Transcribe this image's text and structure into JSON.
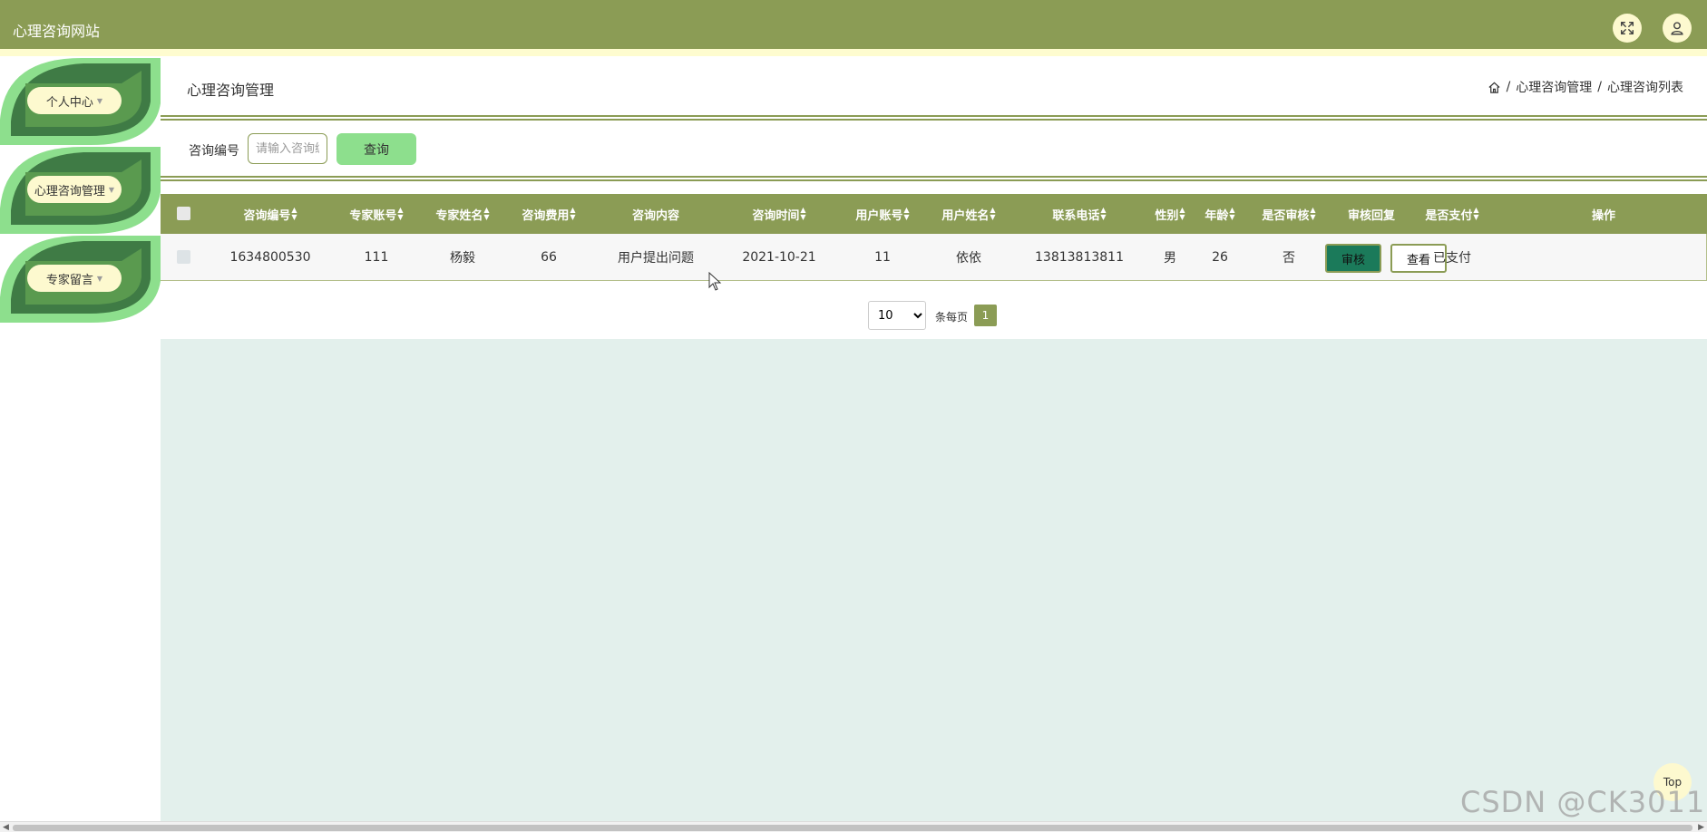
{
  "app": {
    "title": "心理咨询网站"
  },
  "header": {
    "fullscreen_icon": "expand-arrows-icon",
    "user_icon": "user-icon"
  },
  "sidebar": {
    "items": [
      {
        "label": "个人中心"
      },
      {
        "label": "心理咨询管理"
      },
      {
        "label": "专家留言"
      }
    ]
  },
  "page": {
    "title": "心理咨询管理",
    "breadcrumb": [
      "心理咨询管理",
      "心理咨询列表"
    ],
    "breadcrumb_sep": "/"
  },
  "search": {
    "label": "咨询编号",
    "placeholder": "请输入咨询编号",
    "button": "查询"
  },
  "table": {
    "columns": [
      {
        "label": "咨询编号",
        "sortable": true
      },
      {
        "label": "专家账号",
        "sortable": true
      },
      {
        "label": "专家姓名",
        "sortable": true
      },
      {
        "label": "咨询费用",
        "sortable": true
      },
      {
        "label": "咨询内容",
        "sortable": false
      },
      {
        "label": "咨询时间",
        "sortable": true
      },
      {
        "label": "用户账号",
        "sortable": true
      },
      {
        "label": "用户姓名",
        "sortable": true
      },
      {
        "label": "联系电话",
        "sortable": true
      },
      {
        "label": "性别",
        "sortable": true
      },
      {
        "label": "年龄",
        "sortable": true
      },
      {
        "label": "是否审核",
        "sortable": true
      },
      {
        "label": "审核回复",
        "sortable": false
      },
      {
        "label": "是否支付",
        "sortable": true
      },
      {
        "label": "操作",
        "sortable": false
      }
    ],
    "rows": [
      {
        "cells": [
          "1634800530",
          "111",
          "杨毅",
          "66",
          "用户提出问题",
          "2021-10-21",
          "11",
          "依依",
          "13813813811",
          "男",
          "26",
          "否",
          "",
          "已支付"
        ],
        "actions": {
          "audit": "审核",
          "view": "查看"
        }
      }
    ]
  },
  "pagination": {
    "page_size": "10",
    "page_size_options": [
      "10"
    ],
    "per_page_label": "条每页",
    "current_page": "1"
  },
  "back_to_top": "Top",
  "watermark": "CSDN @CK3011",
  "colors": {
    "primary": "#8b9c55",
    "accent_light": "#fdf9cf",
    "button_green": "#8ddf8d",
    "audit_button": "#1b7a5a",
    "background": "#e3f0ec"
  }
}
